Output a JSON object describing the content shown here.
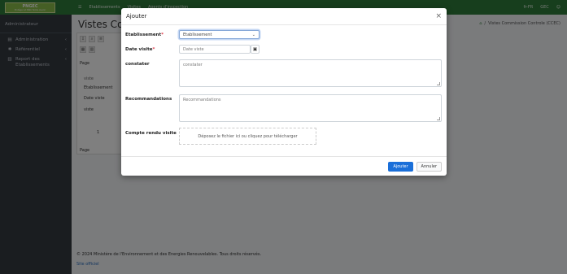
{
  "brand": {
    "title": "PNGEC",
    "subtitle": "Protéger et Bâtir Notre Avenir"
  },
  "sidebar": {
    "user": "Administrateur",
    "items": [
      {
        "label": "Administration",
        "icon": "server-icon"
      },
      {
        "label": "Référentiel",
        "icon": "gear-icon"
      },
      {
        "label": "Report des Etablissements",
        "icon": "chart-icon"
      }
    ]
  },
  "topbar": {
    "items": [
      "Etablissements",
      "Visites",
      "Agents d'inspection"
    ],
    "right": [
      "fr-FR",
      "GEC"
    ]
  },
  "main": {
    "title": "Vistes Commissin Controle (CCEC)",
    "breadcrumb": "Vistes Commission Controle (CCEC)",
    "page_label": "Page",
    "rows": [
      "Etablissement",
      "Date viste",
      "viste"
    ],
    "header_col": "viste",
    "page_number": "1"
  },
  "footer": {
    "copyright": "© 2024 Ministère de l'Environnement et des Energies Renouvelables. Tous droits réservés.",
    "link": "Site officiel"
  },
  "modal": {
    "title": "Ajouter",
    "fields": {
      "etablissement": {
        "label": "Etablissement",
        "value": "Etablissement"
      },
      "date_visite": {
        "label": "Date visite",
        "placeholder": "Date viste"
      },
      "constater": {
        "label": "constater",
        "placeholder": "constater"
      },
      "recommandations": {
        "label": "Recommandations",
        "placeholder": "Recommandations"
      },
      "compte_rendu": {
        "label": "Compte rendu visite",
        "dropzone": "Déposez le fichier ici ou cliquez pour télécharger"
      }
    },
    "buttons": {
      "submit": "Ajouter",
      "cancel": "Annuler"
    }
  },
  "colors": {
    "brand_green": "#2f7d3a",
    "primary": "#1a6fd9",
    "required": "#dc3545"
  }
}
